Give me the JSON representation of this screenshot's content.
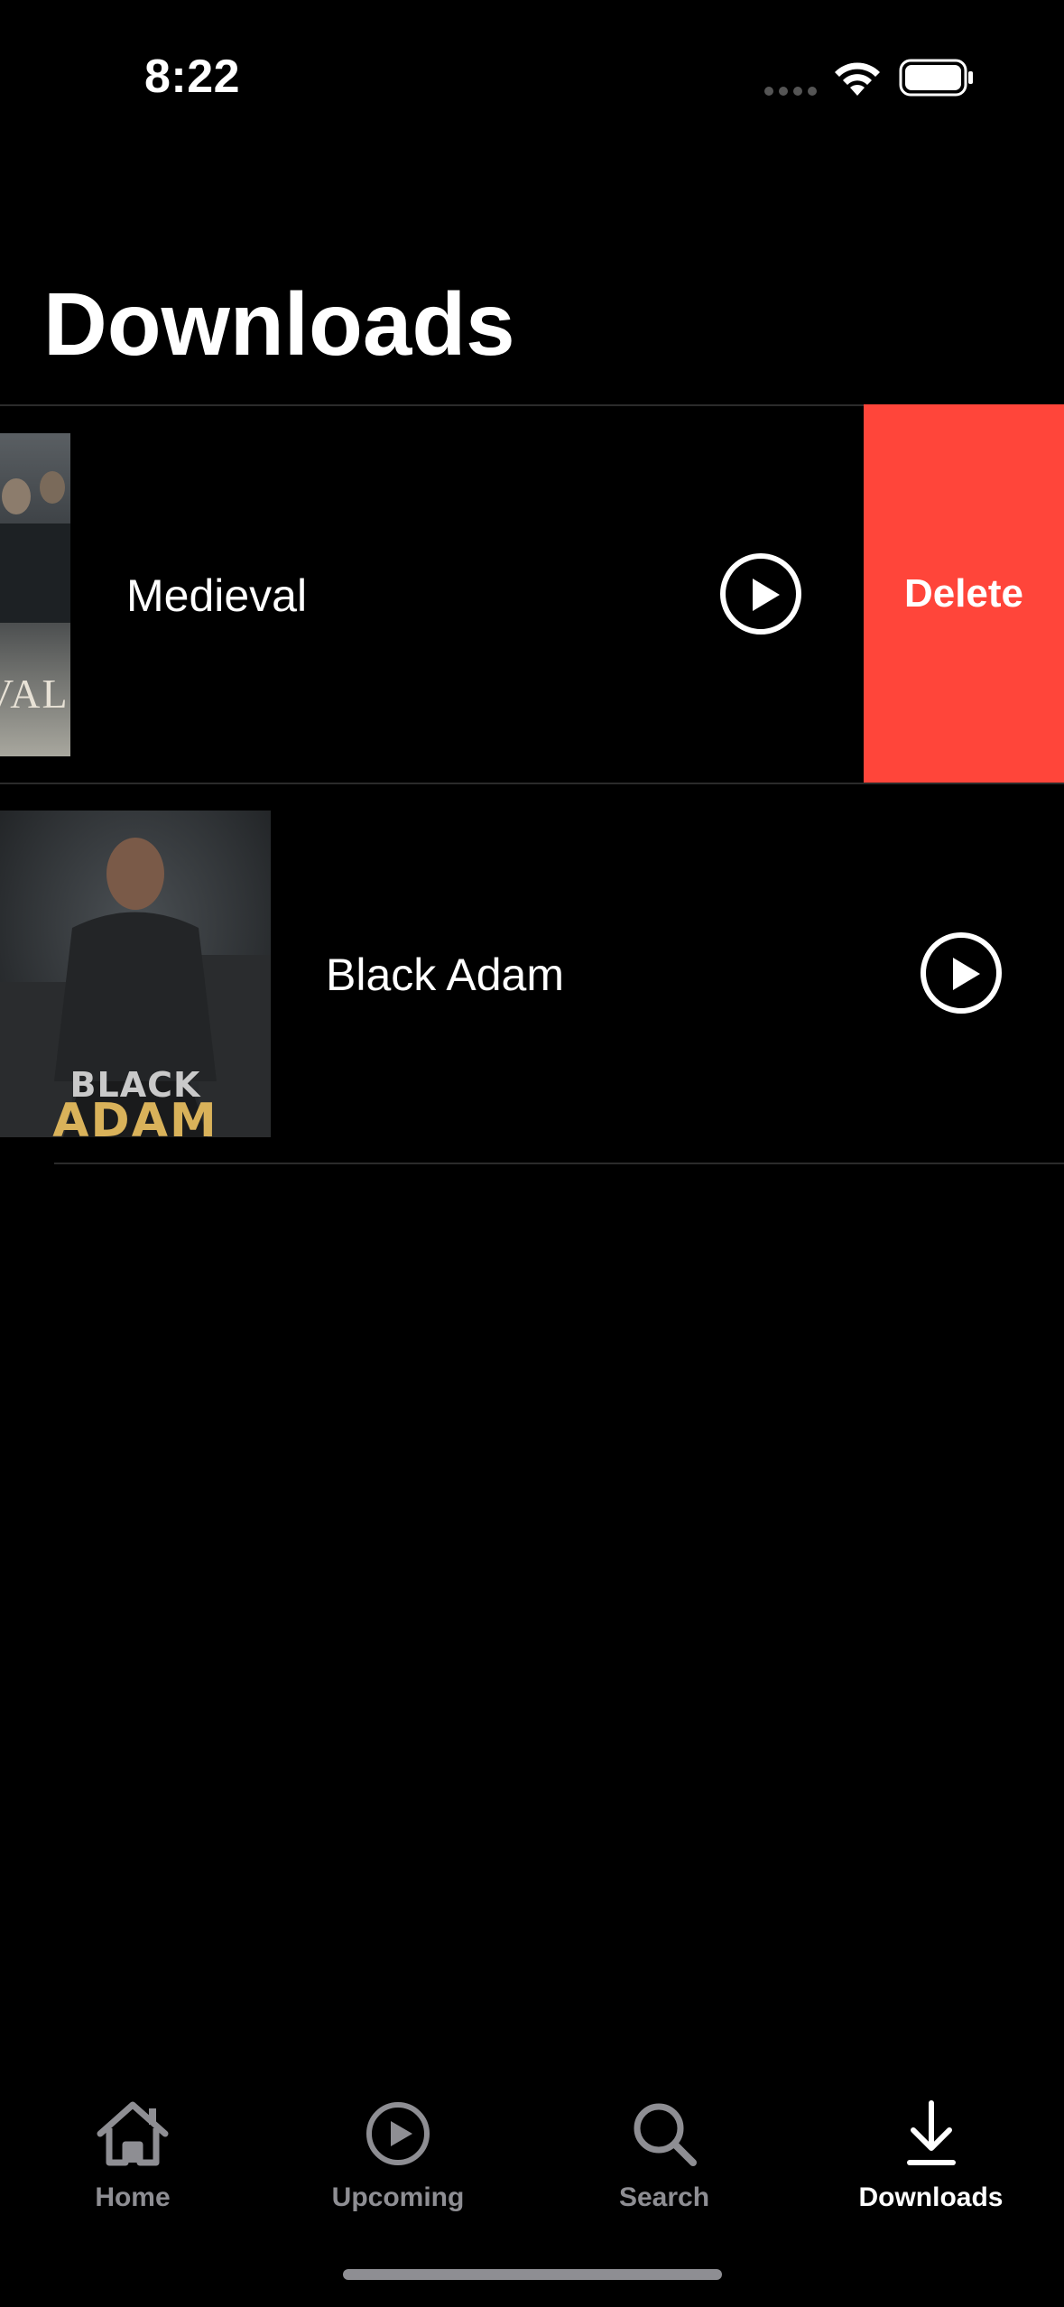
{
  "status_bar": {
    "time": "8:22"
  },
  "page": {
    "title": "Downloads"
  },
  "downloads": [
    {
      "title": "Medieval",
      "poster_text": "VAL",
      "swiped": true,
      "delete_label": "Delete"
    },
    {
      "title": "Black Adam",
      "poster_text_line1": "BLACK",
      "poster_text_line2": "ADAM",
      "swiped": false
    }
  ],
  "tab_bar": {
    "tabs": [
      {
        "label": "Home",
        "icon": "house-icon",
        "active": false
      },
      {
        "label": "Upcoming",
        "icon": "play-circle-icon",
        "active": false
      },
      {
        "label": "Search",
        "icon": "magnifier-icon",
        "active": false
      },
      {
        "label": "Downloads",
        "icon": "download-arrow-icon",
        "active": true
      }
    ]
  },
  "colors": {
    "background": "#000000",
    "delete": "#ff453a",
    "inactive_tab": "#8e8e93",
    "active_tab": "#ffffff"
  }
}
